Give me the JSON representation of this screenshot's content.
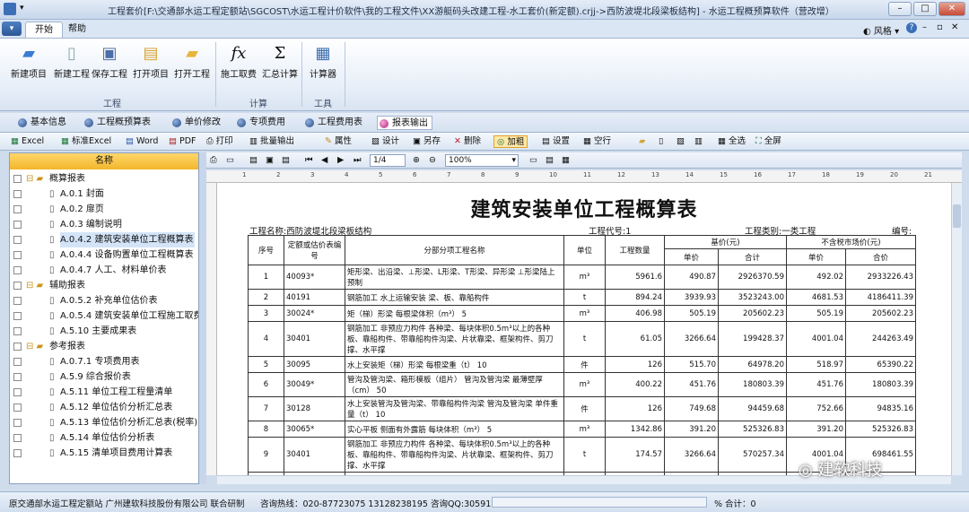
{
  "window": {
    "title": "工程套价[F:\\交通部水运工程定额站\\SGCOST\\水运工程计价软件\\我的工程文件\\XX游艇码头改建工程-水工套价(新定额).crjj->西防波堤北段梁板结构] - 水运工程概预算软件（营改增）"
  },
  "ribbon": {
    "app_button": "▾",
    "tabs": [
      "开始",
      "帮助"
    ],
    "style_label": "风格",
    "groups": [
      {
        "label": "工程",
        "buttons": [
          "新建项目",
          "新建工程",
          "保存工程",
          "打开项目",
          "打开工程"
        ]
      },
      {
        "label": "计算",
        "buttons": [
          "施工取费",
          "汇总计算"
        ]
      },
      {
        "label": "工具",
        "buttons": [
          "计算器"
        ]
      }
    ]
  },
  "nav_tabs": [
    "基本信息",
    "工程概预算表",
    "单价修改",
    "专项费用",
    "工程费用表",
    "报表输出"
  ],
  "toolbar2": [
    "Excel",
    "标准Excel",
    "Word",
    "PDF",
    "打印",
    "批量输出",
    "属性",
    "设计",
    "另存",
    "删除",
    "加粗",
    "设置",
    "空行",
    "全选",
    "全屏"
  ],
  "tree": {
    "header": "名称",
    "items": [
      {
        "label": "概算报表",
        "level": 0
      },
      {
        "label": "A.0.1 封面",
        "level": 1
      },
      {
        "label": "A.0.2 扉页",
        "level": 1
      },
      {
        "label": "A.0.3 编制说明",
        "level": 1
      },
      {
        "label": "A.0.4.2 建筑安装单位工程概算表",
        "level": 1,
        "selected": true
      },
      {
        "label": "A.0.4.4 设备购置单位工程概算表",
        "level": 1
      },
      {
        "label": "A.0.4.7 人工、材料单价表",
        "level": 1
      },
      {
        "label": "辅助报表",
        "level": 0
      },
      {
        "label": "A.0.5.2 补充单位估价表",
        "level": 1
      },
      {
        "label": "A.0.5.4 建筑安装单位工程施工取费",
        "level": 1
      },
      {
        "label": "A.5.10 主要成果表",
        "level": 1
      },
      {
        "label": "参考报表",
        "level": 0
      },
      {
        "label": "A.0.7.1 专项费用表",
        "level": 1
      },
      {
        "label": "A.5.9 综合报价表",
        "level": 1
      },
      {
        "label": "A.5.11 单位工程工程量清单",
        "level": 1
      },
      {
        "label": "A.5.12 单位估价分析汇总表",
        "level": 1
      },
      {
        "label": "A.5.13 单位估价分析汇总表(税率)",
        "level": 1
      },
      {
        "label": "A.5.14 单位估价分析表",
        "level": 1
      },
      {
        "label": "A.5.15 清单项目费用计算表",
        "level": 1
      }
    ]
  },
  "viewer": {
    "page": "1/4",
    "zoom": "100%"
  },
  "report": {
    "title": "建筑安装单位工程概算表",
    "project_name": "工程名称:西防波堤北段梁板结构",
    "project_code": "工程代号:1",
    "project_type": "工程类别:一类工程",
    "serial": "编号:",
    "headers": {
      "seq": "序号",
      "code": "定额或估价表编号",
      "name": "分部分项工程名称",
      "unit": "单位",
      "qty": "工程数量",
      "base": "基价(元)",
      "market": "不含税市场价(元)",
      "unit_price": "单价",
      "total": "合计",
      "unit_price2": "单价",
      "total2": "合价"
    },
    "rows": [
      {
        "seq": "1",
        "code": "40093*",
        "name": "矩形梁、出沿梁、⊥形梁、L形梁、T形梁、异形梁 ⊥形梁陆上预制",
        "unit": "m³",
        "qty": "5961.6",
        "bp": "490.87",
        "bt": "2926370.59",
        "mp": "492.02",
        "mt": "2933226.43"
      },
      {
        "seq": "2",
        "code": "40191",
        "name": "钢筋加工 水上运输安装 梁、板、靠船构件",
        "unit": "t",
        "qty": "894.24",
        "bp": "3939.93",
        "bt": "3523243.00",
        "mp": "4681.53",
        "mt": "4186411.39"
      },
      {
        "seq": "3",
        "code": "30024*",
        "name": "矩（梯）形梁 每根梁体积（m³） 5",
        "unit": "m³",
        "qty": "406.98",
        "bp": "505.19",
        "bt": "205602.23",
        "mp": "505.19",
        "mt": "205602.23"
      },
      {
        "seq": "4",
        "code": "30401",
        "name": "钢筋加工 非预应力构件 各种梁、每块体积0.5m³以上的各种板、靠船构件、带靠船构件沟梁、片状靠梁、框架构件、剪刀撑、水平撑",
        "unit": "t",
        "qty": "61.05",
        "bp": "3266.64",
        "bt": "199428.37",
        "mp": "4001.04",
        "mt": "244263.49"
      },
      {
        "seq": "5",
        "code": "30095",
        "name": "水上安装矩（梯）形梁 每根梁重（t） 10",
        "unit": "件",
        "qty": "126",
        "bp": "515.70",
        "bt": "64978.20",
        "mp": "518.97",
        "mt": "65390.22"
      },
      {
        "seq": "6",
        "code": "30049*",
        "name": "管沟及管沟梁、箱形模板（组片） 管沟及管沟梁 最薄壁厚（cm） 50",
        "unit": "m³",
        "qty": "400.22",
        "bp": "451.76",
        "bt": "180803.39",
        "mp": "451.76",
        "mt": "180803.39"
      },
      {
        "seq": "7",
        "code": "30128",
        "name": "水上安装管沟及管沟梁、带靠船构件沟梁 管沟及管沟梁 单件重量（t） 10",
        "unit": "件",
        "qty": "126",
        "bp": "749.68",
        "bt": "94459.68",
        "mp": "752.66",
        "mt": "94835.16"
      },
      {
        "seq": "8",
        "code": "30065*",
        "name": "实心平板 侧面有外露筋 每块体积（m³） 5",
        "unit": "m³",
        "qty": "1342.86",
        "bp": "391.20",
        "bt": "525326.83",
        "mp": "391.20",
        "mt": "525326.83"
      },
      {
        "seq": "9",
        "code": "30401",
        "name": "钢筋加工 非预应力构件 各种梁、每块体积0.5m³以上的各种板、靠船构件、带靠船构件沟梁、片状靠梁、框架构件、剪刀撑、水平撑",
        "unit": "t",
        "qty": "174.57",
        "bp": "3266.64",
        "bt": "570257.34",
        "mp": "4001.04",
        "mt": "698461.55"
      },
      {
        "seq": "10",
        "code": "30140",
        "name": "水上安装实心平板 有外露筋 单件重量（t） 20",
        "unit": "件",
        "qty": "252",
        "bp": "794.93",
        "bt": "200322.36",
        "mp": "794.93",
        "mt": "200322.36"
      }
    ]
  },
  "status": {
    "org": "原交通部水运工程定额站  广州建软科技股份有限公司 联合研制",
    "hotline": "咨询热线：020-87723075 13128238195 咨询QQ:3059136902",
    "total": "% 合计：0"
  },
  "watermark": "建软科技"
}
